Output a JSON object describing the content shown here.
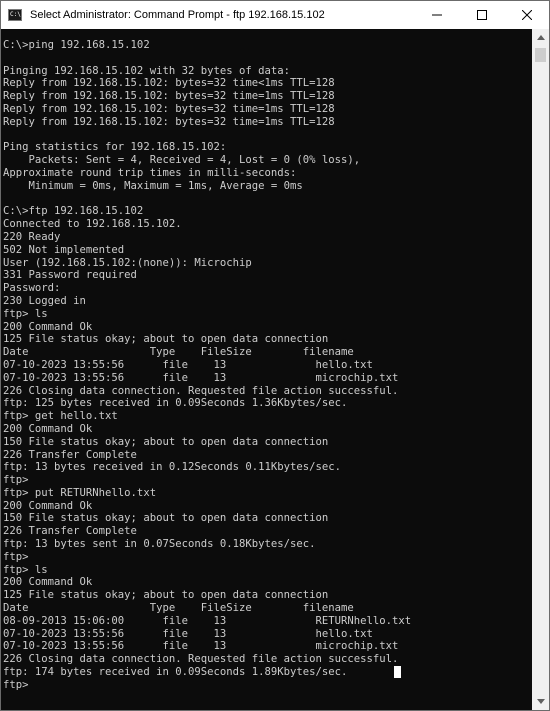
{
  "window": {
    "title": "Select Administrator: Command Prompt - ftp  192.168.15.102",
    "icon": "cmd-icon",
    "icon_text": "C:\\",
    "controls": [
      "minimize",
      "maximize",
      "close"
    ]
  },
  "console": {
    "lines": [
      "C:\\>ping 192.168.15.102",
      "",
      "Pinging 192.168.15.102 with 32 bytes of data:",
      "Reply from 192.168.15.102: bytes=32 time<1ms TTL=128",
      "Reply from 192.168.15.102: bytes=32 time=1ms TTL=128",
      "Reply from 192.168.15.102: bytes=32 time=1ms TTL=128",
      "Reply from 192.168.15.102: bytes=32 time=1ms TTL=128",
      "",
      "Ping statistics for 192.168.15.102:",
      "    Packets: Sent = 4, Received = 4, Lost = 0 (0% loss),",
      "Approximate round trip times in milli-seconds:",
      "    Minimum = 0ms, Maximum = 1ms, Average = 0ms",
      "",
      "C:\\>ftp 192.168.15.102",
      "Connected to 192.168.15.102.",
      "220 Ready",
      "502 Not implemented",
      "User (192.168.15.102:(none)): Microchip",
      "331 Password required",
      "Password:",
      "230 Logged in",
      "ftp> ls",
      "200 Command Ok",
      "125 File status okay; about to open data connection",
      "Date                   Type    FileSize        filename",
      "07-10-2023 13:55:56      file    13              hello.txt",
      "07-10-2023 13:55:56      file    13              microchip.txt",
      "226 Closing data connection. Requested file action successful.",
      "ftp: 125 bytes received in 0.09Seconds 1.36Kbytes/sec.",
      "ftp> get hello.txt",
      "200 Command Ok",
      "150 File status okay; about to open data connection",
      "226 Transfer Complete",
      "ftp: 13 bytes received in 0.12Seconds 0.11Kbytes/sec.",
      "ftp>",
      "ftp> put RETURNhello.txt",
      "200 Command Ok",
      "150 File status okay; about to open data connection",
      "226 Transfer Complete",
      "ftp: 13 bytes sent in 0.07Seconds 0.18Kbytes/sec.",
      "ftp>",
      "ftp> ls",
      "200 Command Ok",
      "125 File status okay; about to open data connection",
      "Date                   Type    FileSize        filename",
      "08-09-2013 15:06:00      file    13              RETURNhello.txt",
      "07-10-2023 13:55:56      file    13              hello.txt",
      "07-10-2023 13:55:56      file    13              microchip.txt",
      "226 Closing data connection. Requested file action successful.",
      "ftp: 174 bytes received in 0.09Seconds 1.89Kbytes/sec.",
      "ftp>"
    ],
    "cursor_after_line": 49,
    "colors": {
      "background": "#0c0c0c",
      "text": "#cccccc",
      "cursor": "#ffffff"
    }
  }
}
